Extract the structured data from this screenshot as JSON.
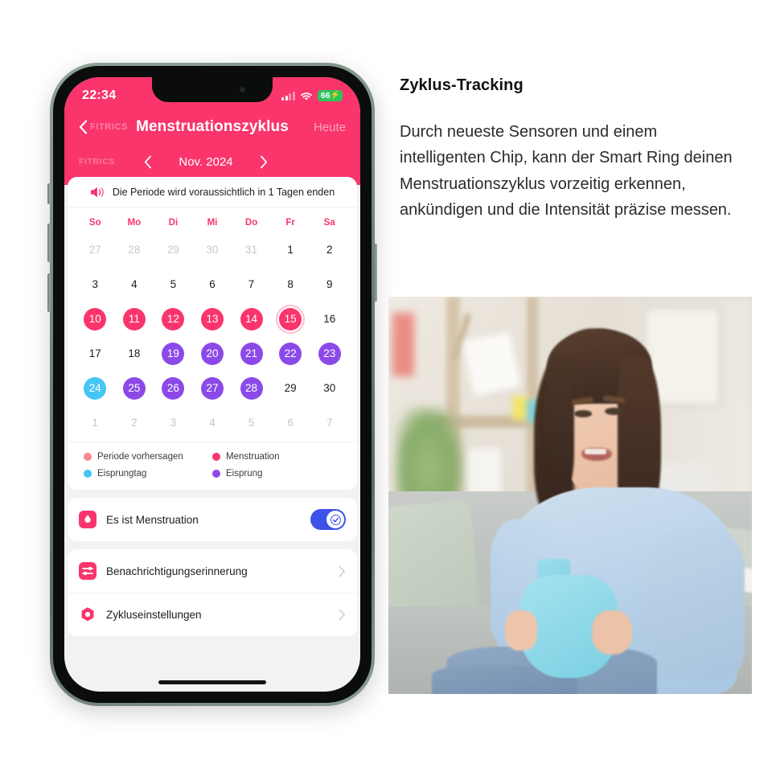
{
  "phone": {
    "status_bar": {
      "time": "22:34",
      "signal_icon": "cellular-signal-icon",
      "wifi_icon": "wifi-icon",
      "battery_percent": "66",
      "battery_charging_glyph": "⚡",
      "battery_color": "#2fc45a"
    },
    "nav": {
      "back_label": "FITRICS",
      "title": "Menstruationszyklus",
      "today_label": "Heute"
    },
    "month_bar": {
      "logo": "FITRICS",
      "prev_icon": "chevron-left-icon",
      "month": "Nov. 2024",
      "next_icon": "chevron-right-icon"
    },
    "banner": {
      "icon": "speaker-announce-icon",
      "text": "Die Periode wird voraussichtlich in 1 Tagen enden"
    },
    "calendar": {
      "weekday_headers": [
        "So",
        "Mo",
        "Di",
        "Mi",
        "Do",
        "Fr",
        "Sa"
      ],
      "weeks": [
        [
          {
            "day": "27",
            "state": "muted"
          },
          {
            "day": "28",
            "state": "muted"
          },
          {
            "day": "29",
            "state": "muted"
          },
          {
            "day": "30",
            "state": "muted"
          },
          {
            "day": "31",
            "state": "muted"
          },
          {
            "day": "1",
            "state": "plain"
          },
          {
            "day": "2",
            "state": "plain"
          }
        ],
        [
          {
            "day": "3",
            "state": "plain"
          },
          {
            "day": "4",
            "state": "plain"
          },
          {
            "day": "5",
            "state": "plain"
          },
          {
            "day": "6",
            "state": "plain"
          },
          {
            "day": "7",
            "state": "plain"
          },
          {
            "day": "8",
            "state": "plain"
          },
          {
            "day": "9",
            "state": "plain"
          }
        ],
        [
          {
            "day": "10",
            "state": "menstruation"
          },
          {
            "day": "11",
            "state": "menstruation"
          },
          {
            "day": "12",
            "state": "menstruation"
          },
          {
            "day": "13",
            "state": "menstruation"
          },
          {
            "day": "14",
            "state": "menstruation"
          },
          {
            "day": "15",
            "state": "menstruation-today"
          },
          {
            "day": "16",
            "state": "plain"
          }
        ],
        [
          {
            "day": "17",
            "state": "plain"
          },
          {
            "day": "18",
            "state": "plain"
          },
          {
            "day": "19",
            "state": "ovulation"
          },
          {
            "day": "20",
            "state": "ovulation"
          },
          {
            "day": "21",
            "state": "ovulation"
          },
          {
            "day": "22",
            "state": "ovulation"
          },
          {
            "day": "23",
            "state": "ovulation"
          }
        ],
        [
          {
            "day": "24",
            "state": "ovulation-day"
          },
          {
            "day": "25",
            "state": "ovulation"
          },
          {
            "day": "26",
            "state": "ovulation"
          },
          {
            "day": "27",
            "state": "ovulation"
          },
          {
            "day": "28",
            "state": "ovulation"
          },
          {
            "day": "29",
            "state": "plain"
          },
          {
            "day": "30",
            "state": "plain"
          }
        ],
        [
          {
            "day": "1",
            "state": "muted"
          },
          {
            "day": "2",
            "state": "muted"
          },
          {
            "day": "3",
            "state": "muted"
          },
          {
            "day": "4",
            "state": "muted"
          },
          {
            "day": "5",
            "state": "muted"
          },
          {
            "day": "6",
            "state": "muted"
          },
          {
            "day": "7",
            "state": "muted"
          }
        ]
      ]
    },
    "legend": [
      {
        "label": "Periode vorhersagen",
        "color": "#f98a8e"
      },
      {
        "label": "Menstruation",
        "color": "#f9356b"
      },
      {
        "label": "Eisprungtag",
        "color": "#44c6f4"
      },
      {
        "label": "Eisprung",
        "color": "#8b4ae8"
      }
    ],
    "rows": [
      {
        "label": "Es ist Menstruation",
        "icon": "blood-drop-icon",
        "control": "toggle",
        "toggle_on": true,
        "toggle_color": "#3d52e8"
      },
      {
        "label": "Benachrichtigungserinnerung",
        "icon": "sliders-icon",
        "control": "chevron"
      },
      {
        "label": "Zykluseinstellungen",
        "icon": "hexagon-settings-icon",
        "control": "chevron"
      }
    ],
    "home_indicator": "home-indicator"
  },
  "article": {
    "title": "Zyklus-Tracking",
    "body": "Durch neueste Sensoren und einem intelligenten Chip, kann der Smart Ring deinen Menstruationszyklus vorzeitig erkennen, ankündigen und die Intensität präzise messen.",
    "photo_alt": "Frau auf Sofa mit blauer Wärmflasche am Bauch"
  },
  "colors": {
    "brand_pink": "#f9356b",
    "menstruation": "#f9356b",
    "ovulation": "#8b4ae8",
    "ovulation_day": "#44c6f4",
    "period_predict": "#f98a8e",
    "toggle_blue": "#3d52e8",
    "battery_green": "#2fc45a"
  }
}
